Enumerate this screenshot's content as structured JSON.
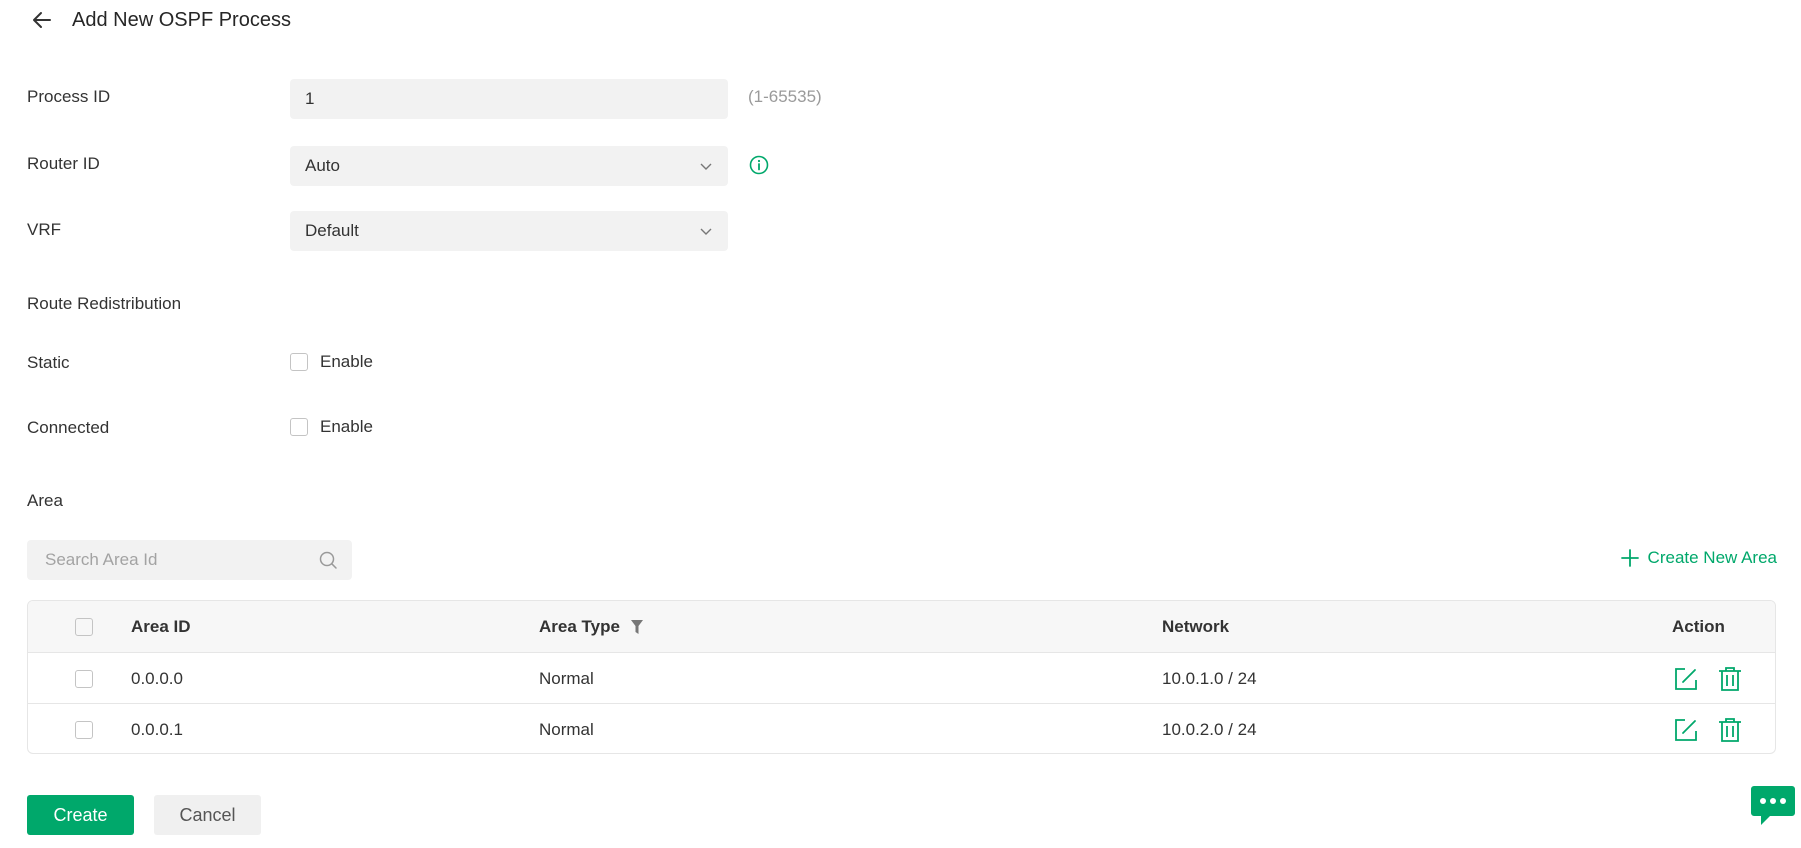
{
  "header": {
    "title": "Add New OSPF Process"
  },
  "form": {
    "process_id": {
      "label": "Process ID",
      "value": "1",
      "hint": "(1-65535)"
    },
    "router_id": {
      "label": "Router ID",
      "value": "Auto"
    },
    "vrf": {
      "label": "VRF",
      "value": "Default"
    },
    "route_redistribution": {
      "title": "Route Redistribution",
      "static": {
        "label": "Static",
        "option": "Enable"
      },
      "connected": {
        "label": "Connected",
        "option": "Enable"
      }
    }
  },
  "area": {
    "title": "Area",
    "search_placeholder": "Search Area Id",
    "create_label": "Create New Area",
    "columns": {
      "area_id": "Area ID",
      "area_type": "Area Type",
      "network": "Network",
      "action": "Action"
    },
    "rows": [
      {
        "area_id": "0.0.0.0",
        "area_type": "Normal",
        "network": "10.0.1.0 / 24"
      },
      {
        "area_id": "0.0.0.1",
        "area_type": "Normal",
        "network": "10.0.2.0 / 24"
      }
    ]
  },
  "footer": {
    "create_label": "Create",
    "cancel_label": "Cancel"
  },
  "icons": {
    "back": "arrow-left-icon",
    "info": "info-icon",
    "chevron": "chevron-down-icon",
    "search": "search-icon",
    "plus": "plus-icon",
    "filter": "filter-icon",
    "edit": "edit-icon",
    "delete": "trash-icon",
    "chat": "chat-icon"
  },
  "colors": {
    "accent": "#00a86b",
    "field_bg": "#f2f2f2",
    "text": "#333333",
    "muted": "#9a9a9a"
  }
}
